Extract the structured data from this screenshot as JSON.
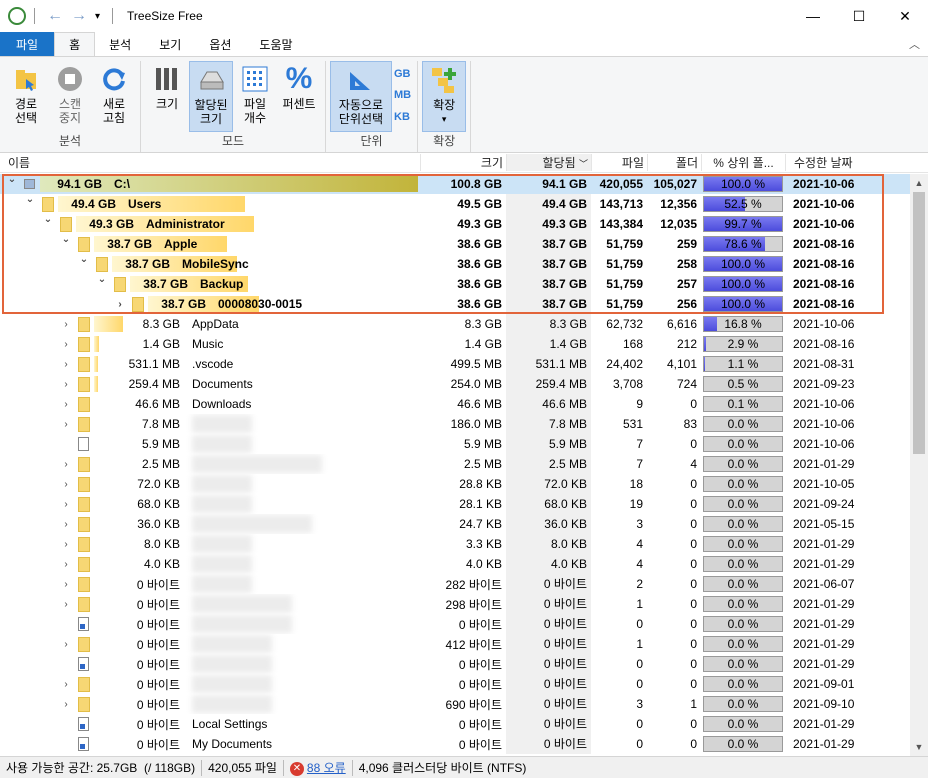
{
  "window": {
    "title": "TreeSize Free"
  },
  "menu": {
    "tabs": [
      "파일",
      "홈",
      "분석",
      "보기",
      "옵션",
      "도움말"
    ]
  },
  "ribbon": {
    "analysis": {
      "label": "분석",
      "select_path": "경로\n선택",
      "scan_stop": "스캔\n중지",
      "refresh": "새로\n고침"
    },
    "mode": {
      "label": "모드",
      "size": "크기",
      "allocated": "할당된\n크기",
      "file_count": "파일\n개수",
      "percent": "퍼센트"
    },
    "units": {
      "label": "단위",
      "auto": "자동으로\n단위선택",
      "gb": "GB",
      "mb": "MB",
      "kb": "KB"
    },
    "expand": {
      "label": "확장",
      "expand": "확장"
    }
  },
  "columns": {
    "name": "이름",
    "size": "크기",
    "allocated": "할당됨",
    "files": "파일",
    "folders": "폴더",
    "pct": "% 상위 폴...",
    "modified": "수정한 날짜"
  },
  "rows": [
    {
      "level": 0,
      "expanded": true,
      "icon": "drive",
      "sizeLabel": "94.1 GB",
      "name": "C:\\",
      "size": "100.8 GB",
      "alloc": "94.1 GB",
      "files": "420,055",
      "folders": "105,027",
      "pct": 100.0,
      "pctText": "100.0 %",
      "date": "2021-10-06",
      "bold": true,
      "bar": 1.0
    },
    {
      "level": 1,
      "expanded": true,
      "icon": "folder",
      "sizeLabel": "49.4 GB",
      "name": "Users",
      "size": "49.5 GB",
      "alloc": "49.4 GB",
      "files": "143,713",
      "folders": "12,356",
      "pct": 52.5,
      "pctText": "52.5 %",
      "date": "2021-10-06",
      "bold": true,
      "bar": 0.52
    },
    {
      "level": 2,
      "expanded": true,
      "icon": "folder",
      "sizeLabel": "49.3 GB",
      "name": "Administrator",
      "size": "49.3 GB",
      "alloc": "49.3 GB",
      "files": "143,384",
      "folders": "12,035",
      "pct": 99.7,
      "pctText": "99.7 %",
      "date": "2021-10-06",
      "bold": true,
      "bar": 0.52
    },
    {
      "level": 3,
      "expanded": true,
      "icon": "folder",
      "sizeLabel": "38.7 GB",
      "name": "Apple",
      "size": "38.6 GB",
      "alloc": "38.7 GB",
      "files": "51,759",
      "folders": "259",
      "pct": 78.6,
      "pctText": "78.6 %",
      "date": "2021-08-16",
      "bold": true,
      "bar": 0.41
    },
    {
      "level": 4,
      "expanded": true,
      "icon": "folder",
      "sizeLabel": "38.7 GB",
      "name": "MobileSync",
      "size": "38.6 GB",
      "alloc": "38.7 GB",
      "files": "51,759",
      "folders": "258",
      "pct": 100.0,
      "pctText": "100.0 %",
      "date": "2021-08-16",
      "bold": true,
      "bar": 0.41
    },
    {
      "level": 5,
      "expanded": true,
      "icon": "folder",
      "sizeLabel": "38.7 GB",
      "name": "Backup",
      "size": "38.6 GB",
      "alloc": "38.7 GB",
      "files": "51,759",
      "folders": "257",
      "pct": 100.0,
      "pctText": "100.0 %",
      "date": "2021-08-16",
      "bold": true,
      "bar": 0.41
    },
    {
      "level": 6,
      "expanded": false,
      "icon": "folder",
      "sizeLabel": "38.7 GB",
      "name": "00008030-0015",
      "size": "38.6 GB",
      "alloc": "38.7 GB",
      "files": "51,759",
      "folders": "256",
      "pct": 100.0,
      "pctText": "100.0 %",
      "date": "2021-08-16",
      "bold": true,
      "bar": 0.41
    },
    {
      "level": 3,
      "expanded": false,
      "icon": "folder",
      "sizeLabel": "8.3 GB",
      "name": "AppData",
      "size": "8.3 GB",
      "alloc": "8.3 GB",
      "files": "62,732",
      "folders": "6,616",
      "pct": 16.8,
      "pctText": "16.8 %",
      "date": "2021-10-06",
      "bar": 0.09
    },
    {
      "level": 3,
      "expanded": false,
      "icon": "folder",
      "sizeLabel": "1.4 GB",
      "name": "Music",
      "size": "1.4 GB",
      "alloc": "1.4 GB",
      "files": "168",
      "folders": "212",
      "pct": 2.9,
      "pctText": "2.9 %",
      "date": "2021-08-16",
      "bar": 0.015
    },
    {
      "level": 3,
      "expanded": false,
      "icon": "folder",
      "sizeLabel": "531.1 MB",
      "name": ".vscode",
      "size": "499.5 MB",
      "alloc": "531.1 MB",
      "files": "24,402",
      "folders": "4,101",
      "pct": 1.1,
      "pctText": "1.1 %",
      "date": "2021-08-31",
      "bar": 0.006
    },
    {
      "level": 3,
      "expanded": false,
      "icon": "folder",
      "sizeLabel": "259.4 MB",
      "name": "Documents",
      "size": "254.0 MB",
      "alloc": "259.4 MB",
      "files": "3,708",
      "folders": "724",
      "pct": 0.5,
      "pctText": "0.5 %",
      "date": "2021-09-23",
      "bar": 0.003
    },
    {
      "level": 3,
      "expanded": false,
      "icon": "folder",
      "sizeLabel": "46.6 MB",
      "name": "Downloads",
      "size": "46.6 MB",
      "alloc": "46.6 MB",
      "files": "9",
      "folders": "0",
      "pct": 0.1,
      "pctText": "0.1 %",
      "date": "2021-10-06",
      "bar": 0
    },
    {
      "level": 3,
      "expanded": false,
      "icon": "folder",
      "sizeLabel": "7.8 MB",
      "name": "",
      "size": "186.0 MB",
      "alloc": "7.8 MB",
      "files": "531",
      "folders": "83",
      "pct": 0.0,
      "pctText": "0.0 %",
      "date": "2021-10-06",
      "bar": 0,
      "blur": 60
    },
    {
      "level": 3,
      "expanded": false,
      "icon": "file",
      "noexp": true,
      "sizeLabel": "5.9 MB",
      "name": "",
      "size": "5.9 MB",
      "alloc": "5.9 MB",
      "files": "7",
      "folders": "0",
      "pct": 0.0,
      "pctText": "0.0 %",
      "date": "2021-10-06",
      "bar": 0,
      "blur": 60
    },
    {
      "level": 3,
      "expanded": false,
      "icon": "folder",
      "sizeLabel": "2.5 MB",
      "name": "",
      "size": "2.5 MB",
      "alloc": "2.5 MB",
      "files": "7",
      "folders": "4",
      "pct": 0.0,
      "pctText": "0.0 %",
      "date": "2021-01-29",
      "bar": 0,
      "blur": 130
    },
    {
      "level": 3,
      "expanded": false,
      "icon": "folder",
      "sizeLabel": "72.0 KB",
      "name": "",
      "size": "28.8 KB",
      "alloc": "72.0 KB",
      "files": "18",
      "folders": "0",
      "pct": 0.0,
      "pctText": "0.0 %",
      "date": "2021-10-05",
      "bar": 0,
      "blur": 60
    },
    {
      "level": 3,
      "expanded": false,
      "icon": "folder",
      "sizeLabel": "68.0 KB",
      "name": "",
      "size": "28.1 KB",
      "alloc": "68.0 KB",
      "files": "19",
      "folders": "0",
      "pct": 0.0,
      "pctText": "0.0 %",
      "date": "2021-09-24",
      "bar": 0,
      "blur": 60
    },
    {
      "level": 3,
      "expanded": false,
      "icon": "folder",
      "sizeLabel": "36.0 KB",
      "name": "",
      "size": "24.7 KB",
      "alloc": "36.0 KB",
      "files": "3",
      "folders": "0",
      "pct": 0.0,
      "pctText": "0.0 %",
      "date": "2021-05-15",
      "bar": 0,
      "blur": 120
    },
    {
      "level": 3,
      "expanded": false,
      "icon": "folder",
      "sizeLabel": "8.0 KB",
      "name": "",
      "size": "3.3 KB",
      "alloc": "8.0 KB",
      "files": "4",
      "folders": "0",
      "pct": 0.0,
      "pctText": "0.0 %",
      "date": "2021-01-29",
      "bar": 0,
      "blur": 60
    },
    {
      "level": 3,
      "expanded": false,
      "icon": "folder",
      "sizeLabel": "4.0 KB",
      "name": "",
      "size": "4.0 KB",
      "alloc": "4.0 KB",
      "files": "4",
      "folders": "0",
      "pct": 0.0,
      "pctText": "0.0 %",
      "date": "2021-01-29",
      "bar": 0,
      "blur": 60
    },
    {
      "level": 3,
      "expanded": false,
      "icon": "folder",
      "sizeLabel": "0 바이트",
      "name": "",
      "size": "282 바이트",
      "alloc": "0 바이트",
      "files": "2",
      "folders": "0",
      "pct": 0.0,
      "pctText": "0.0 %",
      "date": "2021-06-07",
      "bar": 0,
      "blur": 60
    },
    {
      "level": 3,
      "expanded": false,
      "icon": "folder",
      "sizeLabel": "0 바이트",
      "name": "",
      "size": "298 바이트",
      "alloc": "0 바이트",
      "files": "1",
      "folders": "0",
      "pct": 0.0,
      "pctText": "0.0 %",
      "date": "2021-01-29",
      "bar": 0,
      "blur": 100
    },
    {
      "level": 3,
      "expanded": false,
      "icon": "link",
      "noexp": true,
      "sizeLabel": "0 바이트",
      "name": "",
      "size": "0 바이트",
      "alloc": "0 바이트",
      "files": "0",
      "folders": "0",
      "pct": 0.0,
      "pctText": "0.0 %",
      "date": "2021-01-29",
      "bar": 0,
      "blur": 100
    },
    {
      "level": 3,
      "expanded": false,
      "icon": "folder",
      "sizeLabel": "0 바이트",
      "name": "",
      "size": "412 바이트",
      "alloc": "0 바이트",
      "files": "1",
      "folders": "0",
      "pct": 0.0,
      "pctText": "0.0 %",
      "date": "2021-01-29",
      "bar": 0,
      "blur": 80
    },
    {
      "level": 3,
      "expanded": false,
      "icon": "link",
      "noexp": true,
      "sizeLabel": "0 바이트",
      "name": "",
      "size": "0 바이트",
      "alloc": "0 바이트",
      "files": "0",
      "folders": "0",
      "pct": 0.0,
      "pctText": "0.0 %",
      "date": "2021-01-29",
      "bar": 0,
      "blur": 80
    },
    {
      "level": 3,
      "expanded": false,
      "icon": "folder",
      "sizeLabel": "0 바이트",
      "name": "",
      "size": "0 바이트",
      "alloc": "0 바이트",
      "files": "0",
      "folders": "0",
      "pct": 0.0,
      "pctText": "0.0 %",
      "date": "2021-09-01",
      "bar": 0,
      "blur": 80
    },
    {
      "level": 3,
      "expanded": false,
      "icon": "folder",
      "sizeLabel": "0 바이트",
      "name": "",
      "size": "690 바이트",
      "alloc": "0 바이트",
      "files": "3",
      "folders": "1",
      "pct": 0.0,
      "pctText": "0.0 %",
      "date": "2021-09-10",
      "bar": 0,
      "blur": 80
    },
    {
      "level": 3,
      "expanded": false,
      "icon": "link",
      "noexp": true,
      "sizeLabel": "0 바이트",
      "name": "Local Settings",
      "size": "0 바이트",
      "alloc": "0 바이트",
      "files": "0",
      "folders": "0",
      "pct": 0.0,
      "pctText": "0.0 %",
      "date": "2021-01-29",
      "bar": 0
    },
    {
      "level": 3,
      "expanded": false,
      "icon": "link",
      "noexp": true,
      "sizeLabel": "0 바이트",
      "name": "My Documents",
      "size": "0 바이트",
      "alloc": "0 바이트",
      "files": "0",
      "folders": "0",
      "pct": 0.0,
      "pctText": "0.0 %",
      "date": "2021-01-29",
      "bar": 0
    }
  ],
  "status": {
    "free_space": "사용 가능한 공간: 25.7GB",
    "total": "(/ 118GB)",
    "files": "420,055 파일",
    "errors": "88 오류",
    "cluster": "4,096 클러스터당 바이트 (NTFS)"
  }
}
